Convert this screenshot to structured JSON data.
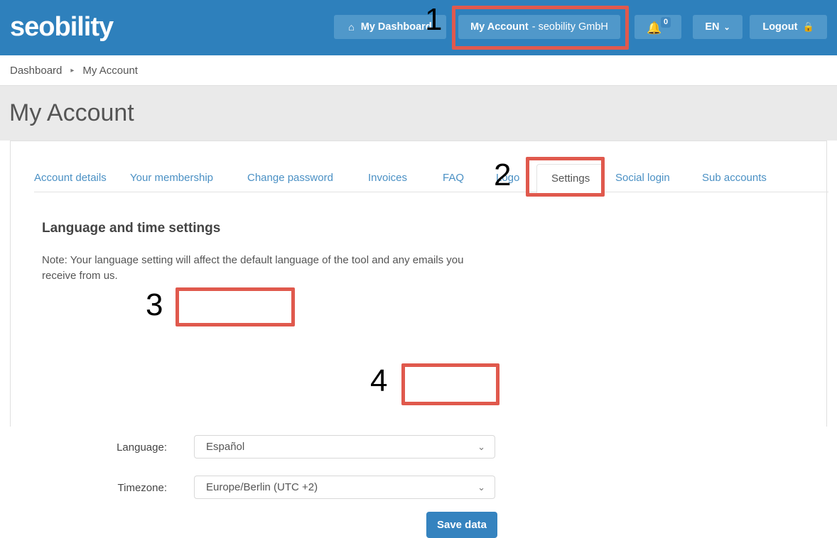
{
  "header": {
    "logo": "seobility",
    "dashboard_button": "My Dashboard",
    "home_icon": "⌂",
    "account_button": "My Account",
    "account_company": "- seobility GmbH",
    "bell_icon": "🔔",
    "bell_count": "0",
    "language_button": "EN",
    "chevron_icon": "⌄",
    "logout_button": "Logout",
    "lock_icon": "🔒",
    "bg_color": "#2e80bc",
    "button_color": "#5098ca"
  },
  "breadcrumb": {
    "root": "Dashboard",
    "separator": "▸",
    "current": "My Account"
  },
  "page": {
    "title": "My Account",
    "band_color": "#eaeaea"
  },
  "tabs": [
    {
      "label": "Account details",
      "active": false
    },
    {
      "label": "Your membership",
      "active": false
    },
    {
      "label": "Change password",
      "active": false
    },
    {
      "label": "Invoices",
      "active": false
    },
    {
      "label": "FAQ",
      "active": false
    },
    {
      "label": "Logo",
      "active": false
    },
    {
      "label": "Settings",
      "active": true
    },
    {
      "label": "Social login",
      "active": false
    },
    {
      "label": "Sub accounts",
      "active": false
    }
  ],
  "settings": {
    "section_title": "Language and time settings",
    "note": "Note: Your language setting will affect the default language of the tool and any emails you receive from us.",
    "language_label": "Language:",
    "language_value": "Español",
    "timezone_label": "Timezone:",
    "timezone_value": "Europe/Berlin (UTC +2)",
    "caret_icon": "⌄",
    "save_button": "Save data",
    "save_color": "#3583bf"
  },
  "annotations": {
    "color": "#e0594d",
    "items": [
      {
        "number": "1",
        "target": "account-button"
      },
      {
        "number": "2",
        "target": "settings-tab"
      },
      {
        "number": "3",
        "target": "language-select"
      },
      {
        "number": "4",
        "target": "save-button"
      }
    ]
  }
}
